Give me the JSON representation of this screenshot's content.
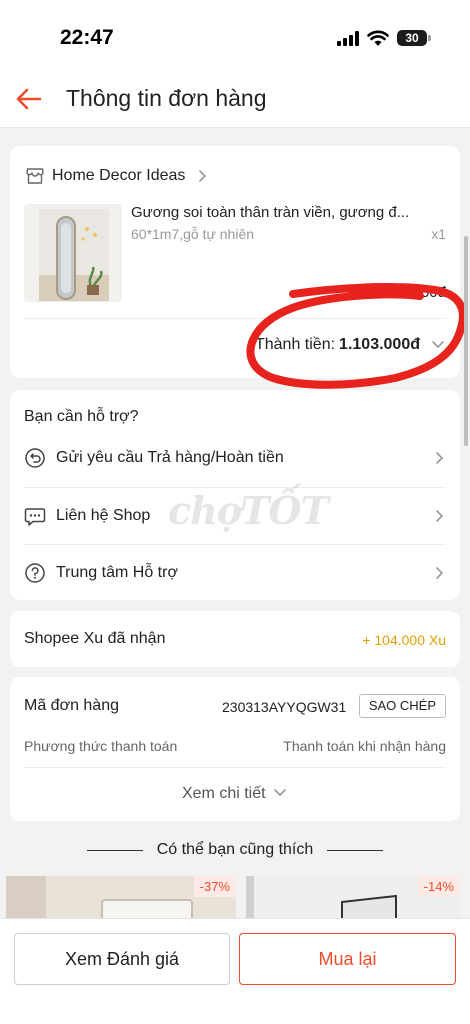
{
  "status_bar": {
    "time": "22:47",
    "battery": "30"
  },
  "header": {
    "title": "Thông tin đơn hàng"
  },
  "product_card": {
    "shop_name": "Home Decor Ideas",
    "product_name": "Gương soi toàn thân tràn viền, gương đ...",
    "variant": "60*1m7,gỗ tự nhiên",
    "quantity": "x1",
    "price": "1.000.000đ",
    "total_label": "Thành tiền:",
    "total_value": "1.103.000đ"
  },
  "support": {
    "title": "Bạn cần hỗ trợ?",
    "items": [
      {
        "label": "Gửi yêu cầu Trả hàng/Hoàn tiền",
        "icon": "return-icon"
      },
      {
        "label": "Liên hệ Shop",
        "icon": "chat-icon"
      },
      {
        "label": "Trung tâm Hỗ trợ",
        "icon": "help-icon"
      }
    ]
  },
  "xu": {
    "label": "Shopee Xu đã nhận",
    "value": "+ 104.000 Xu"
  },
  "order": {
    "label": "Mã đơn hàng",
    "code": "230313AYYQGW31",
    "copy_label": "SAO CHÉP",
    "payment_label": "Phương thức thanh toán",
    "payment_value": "Thanh toán khi nhận hàng",
    "detail_label": "Xem chi tiết"
  },
  "recommend": {
    "title": "Có thể bạn cũng thích",
    "items": [
      {
        "discount": "-37%"
      },
      {
        "discount": "-14%"
      }
    ]
  },
  "watermark": "chợTỐT",
  "bottom": {
    "review_label": "Xem Đánh giá",
    "rebuy_label": "Mua lại"
  },
  "colors": {
    "accent": "#ee4d2d",
    "xu": "#e0a100",
    "annotation": "#e8221c"
  }
}
